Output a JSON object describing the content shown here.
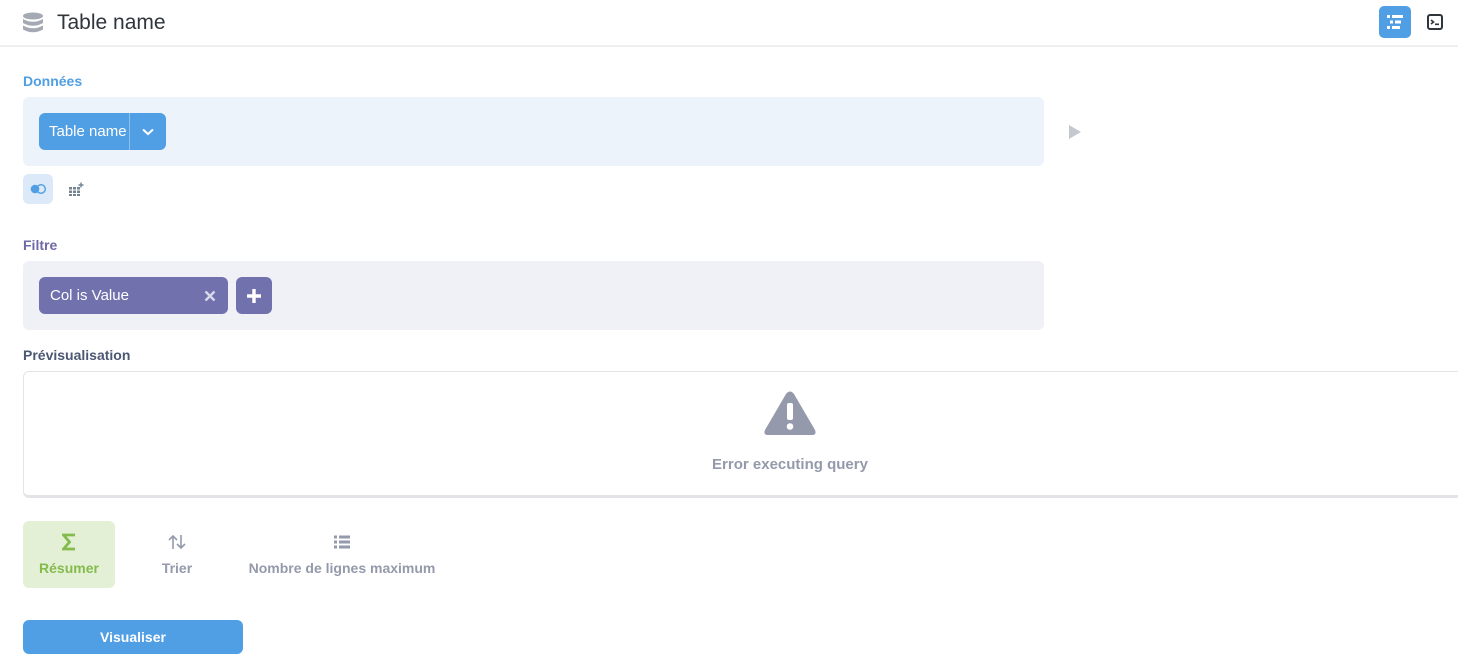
{
  "header": {
    "title": "Table name",
    "icon": "database-icon"
  },
  "toolbar": {
    "notebook_icon": "notebook-editor-icon",
    "sql_icon": "sql-editor-icon"
  },
  "data_section": {
    "label": "Données",
    "table_pill": "Table name",
    "run_icon": "play-icon"
  },
  "filter_section": {
    "label": "Filtre",
    "filters": [
      {
        "label": "Col is Value"
      }
    ]
  },
  "preview_section": {
    "label": "Prévisualisation",
    "error": "Error executing query"
  },
  "steps": {
    "summarize": "Résumer",
    "sort": "Trier",
    "limit": "Nombre de lignes maximum"
  },
  "actions": {
    "visualize": "Visualiser"
  },
  "colors": {
    "brand": "#509ee3",
    "filter": "#7172ad",
    "summarize": "#84bb4c",
    "muted": "#949aab"
  }
}
